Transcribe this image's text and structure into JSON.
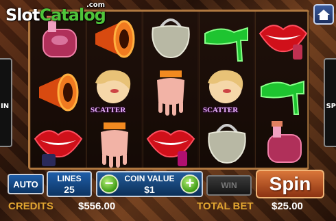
{
  "logo": {
    "part1": "Slot",
    "part2": "Catalog",
    "suffix": ".com"
  },
  "side_panels": {
    "left_text": "IN",
    "right_text": "SP"
  },
  "reels": {
    "columns": [
      [
        "perfume-bottle-icon",
        "megaphone-icon",
        "lips-lipstick-icon"
      ],
      [
        "megaphone-icon",
        "scatter-woman-icon",
        "manicure-hand-icon"
      ],
      [
        "handbag-icon",
        "manicure-hand-icon",
        "lips-lipstick-icon"
      ],
      [
        "green-shoes-icon",
        "scatter-woman-icon",
        "handbag-icon"
      ],
      [
        "lips-lipstick-icon",
        "green-shoes-icon",
        "perfume-bottle-icon"
      ]
    ],
    "scatter_label": "SCATTER"
  },
  "controls": {
    "auto_label": "AUTO",
    "lines_label": "LINES",
    "lines_value": "25",
    "coin_label": "COIN VALUE",
    "coin_value": "$1",
    "minus_label": "−",
    "plus_label": "+",
    "win_label": "WIN",
    "spin_label": "Spin"
  },
  "meters": {
    "credits_label": "CREDITS",
    "credits_value": "$556.00",
    "total_bet_label": "TOTAL BET",
    "total_bet_value": "$25.00"
  },
  "colors": {
    "accent": "#e1a531",
    "green": "#4fc33a",
    "button_blue": "#1f5ea8",
    "spin_orange": "#d9763a"
  }
}
